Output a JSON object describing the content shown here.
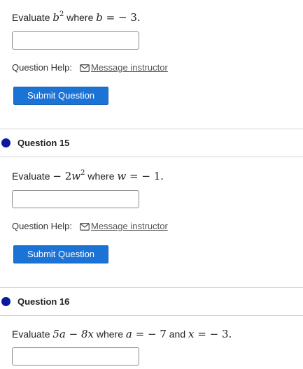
{
  "colors": {
    "accent_button": "#1c73d6",
    "status_dot": "#0a1a9e",
    "divider": "#d4d4d4"
  },
  "icons": {
    "message": "mail-envelope-icon",
    "status": "filled-circle"
  },
  "q14": {
    "prompt_word": "Evaluate",
    "expr_base": "b",
    "expr_exp": "2",
    "where": "where",
    "var": "b",
    "eq": "=",
    "value": "− 3.",
    "answer_value": "",
    "help_label": "Question Help:",
    "message_label": "Message instructor",
    "submit_label": "Submit Question"
  },
  "q15": {
    "title": "Question 15",
    "prompt_word": "Evaluate",
    "expr_prefix": "− 2",
    "expr_base": "w",
    "expr_exp": "2",
    "where": "where",
    "var": "w",
    "eq": "=",
    "value": "− 1.",
    "answer_value": "",
    "help_label": "Question Help:",
    "message_label": "Message instructor",
    "submit_label": "Submit Question"
  },
  "q16": {
    "title": "Question 16",
    "prompt_word": "Evaluate",
    "expr": "5a − 8x",
    "where": "where",
    "var1": "a",
    "eq": "=",
    "value1": "− 7",
    "and": "and",
    "var2": "x",
    "value2": "− 3.",
    "answer_value": ""
  }
}
